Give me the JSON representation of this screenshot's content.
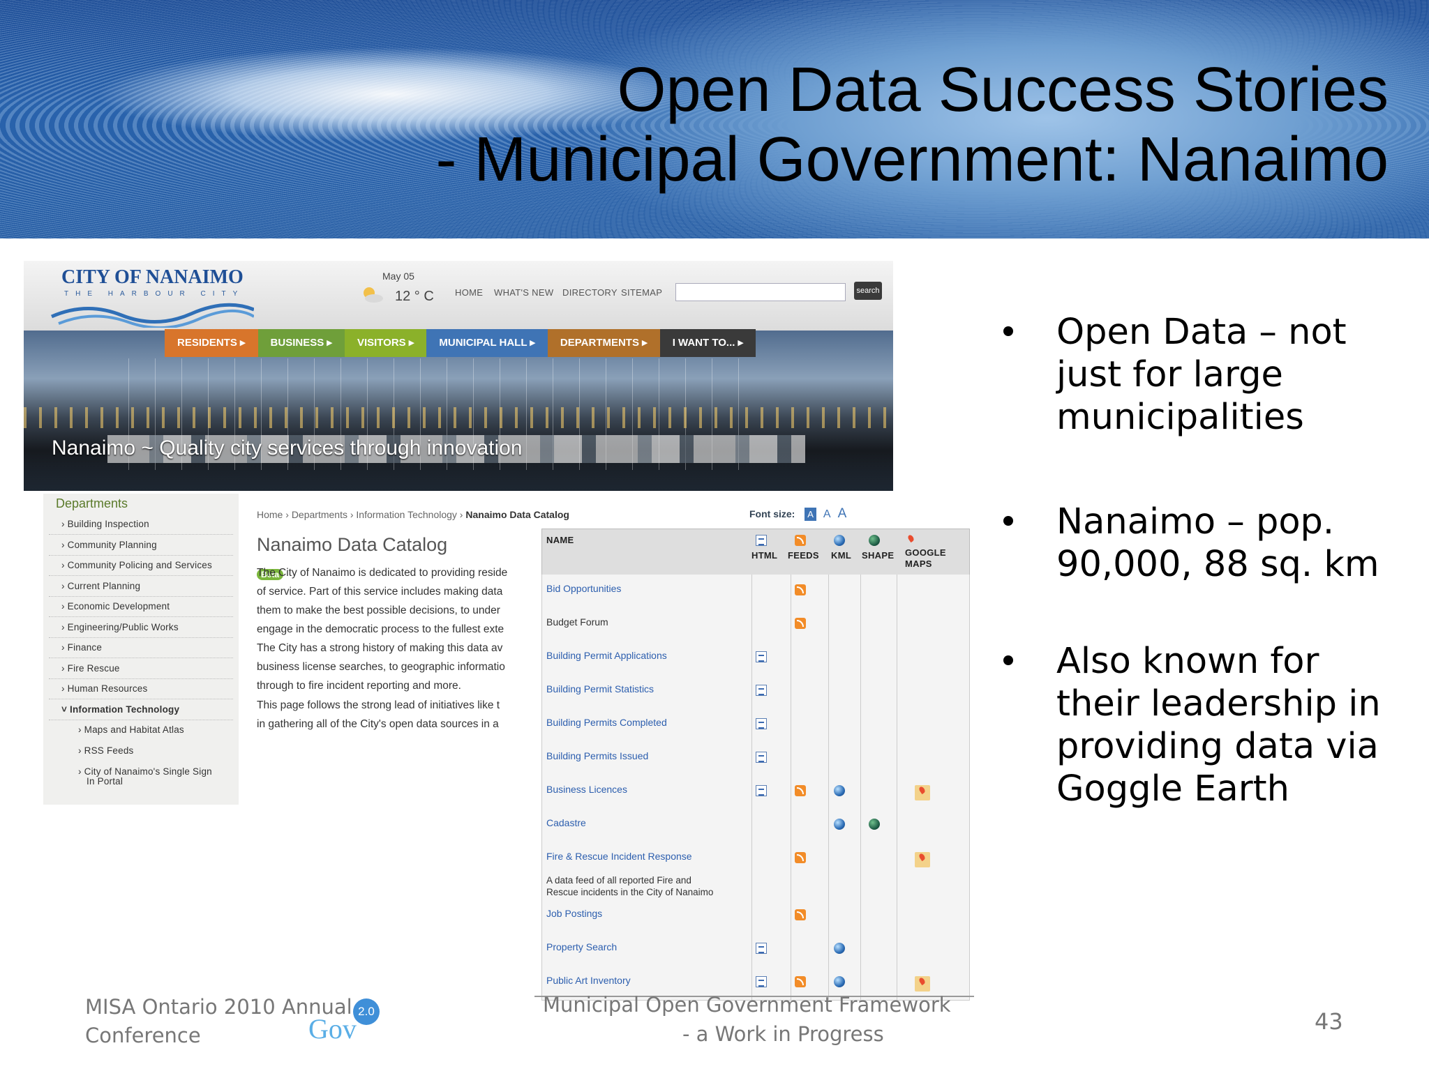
{
  "slide": {
    "title_line1": "Open Data Success Stories",
    "title_line2": "- Municipal Government:  Nanaimo",
    "bullets": [
      {
        "lines": [
          "Open Data – not",
          "just for large",
          "municipalities"
        ]
      },
      {
        "lines": [
          "Nanaimo – pop.",
          "90,000, 88 sq. km"
        ]
      },
      {
        "lines": [
          "Also known for",
          "their leadership in",
          "providing data via",
          "Goggle Earth"
        ]
      }
    ],
    "footer_left_line1": "MISA Ontario 2010 Annual",
    "footer_left_line2": "Conference",
    "footer_logo_version": "2.0",
    "footer_logo_word": "Gov",
    "footer_center_line1": "Municipal Open Government Framework",
    "footer_center_line2": "- a Work in Progress",
    "page_number": "43"
  },
  "site": {
    "logo_title": "CITY OF NANAIMO",
    "logo_sub": "THE HARBOUR CITY",
    "date": "May 05",
    "temperature": "12 ° C",
    "top_links": [
      "HOME",
      "WHAT'S NEW",
      "DIRECTORY",
      "SITEMAP"
    ],
    "search_button": "search",
    "main_nav": [
      {
        "label": "RESIDENTS",
        "color": "#d8752b"
      },
      {
        "label": "BUSINESS",
        "color": "#6f9f3a"
      },
      {
        "label": "VISITORS",
        "color": "#8bb12a"
      },
      {
        "label": "MUNICIPAL HALL",
        "color": "#3f74b5"
      },
      {
        "label": "DEPARTMENTS",
        "color": "#b0702a"
      },
      {
        "label": "I WANT TO...",
        "color": "#3a3a3a"
      }
    ],
    "tagline": "Nanaimo ~ Quality city services through innovation",
    "sidebar_heading": "Departments",
    "sidebar_items": [
      "Building Inspection",
      "Community Planning",
      "Community Policing and Services",
      "Current Planning",
      "Economic Development",
      "Engineering/Public Works",
      "Finance",
      "Fire Rescue",
      "Human Resources",
      "Information Technology"
    ],
    "sidebar_subitems": [
      "Maps and Habitat Atlas",
      "RSS Feeds",
      "City of Nanaimo's Single Sign",
      "In Portal"
    ],
    "breadcrumb": [
      "Home",
      "Departments",
      "Information Technology",
      "Nanaimo Data Catalog"
    ],
    "font_size_label": "Font size:",
    "font_size_options": [
      "A",
      "A",
      "A"
    ],
    "page_heading": "Nanaimo Data Catalog",
    "beta": "Beta",
    "para1": [
      "The City of Nanaimo is dedicated to providing reside",
      "of service.  Part of this service includes making data",
      "them to make the best possible decisions, to under",
      "engage in the democratic process to the fullest exte"
    ],
    "para2": [
      "The City has a strong history of making this data av",
      "business license searches, to geographic informatio",
      "through to fire incident reporting and more."
    ],
    "para3": [
      "This page follows the strong lead of initiatives like t",
      " in gathering all of the City's open data sources in a"
    ],
    "table": {
      "headers": {
        "name": "NAME",
        "html": "HTML",
        "feeds": "FEEDS",
        "kml": "KML",
        "shape": "SHAPE",
        "gmaps1": "GOOGLE",
        "gmaps2": "MAPS"
      },
      "rows": [
        {
          "name": "Bid Opportunities",
          "desc": [],
          "html": false,
          "feeds": true,
          "kml": false,
          "shape": false,
          "gmaps": false,
          "link": true
        },
        {
          "name": "Budget Forum",
          "desc": [],
          "html": false,
          "feeds": true,
          "kml": false,
          "shape": false,
          "gmaps": false,
          "link": false
        },
        {
          "name": "Building Permit Applications",
          "desc": [],
          "html": true,
          "feeds": false,
          "kml": false,
          "shape": false,
          "gmaps": false,
          "link": true
        },
        {
          "name": "Building Permit Statistics",
          "desc": [],
          "html": true,
          "feeds": false,
          "kml": false,
          "shape": false,
          "gmaps": false,
          "link": true
        },
        {
          "name": "Building Permits Completed",
          "desc": [],
          "html": true,
          "feeds": false,
          "kml": false,
          "shape": false,
          "gmaps": false,
          "link": true
        },
        {
          "name": "Building Permits Issued",
          "desc": [],
          "html": true,
          "feeds": false,
          "kml": false,
          "shape": false,
          "gmaps": false,
          "link": true
        },
        {
          "name": "Business Licences",
          "desc": [],
          "html": true,
          "feeds": true,
          "kml": true,
          "shape": false,
          "gmaps": true,
          "link": true
        },
        {
          "name": "Cadastre",
          "desc": [],
          "html": false,
          "feeds": false,
          "kml": true,
          "shape": true,
          "gmaps": false,
          "link": true
        },
        {
          "name": "Fire & Rescue Incident Response",
          "desc": [
            "A data feed of all reported Fire and",
            "Rescue incidents in the City of Nanaimo"
          ],
          "html": false,
          "feeds": true,
          "kml": false,
          "shape": false,
          "gmaps": true,
          "link": true
        },
        {
          "name": "Job Postings",
          "desc": [],
          "html": false,
          "feeds": true,
          "kml": false,
          "shape": false,
          "gmaps": false,
          "link": true
        },
        {
          "name": "Property Search",
          "desc": [],
          "html": true,
          "feeds": false,
          "kml": true,
          "shape": false,
          "gmaps": false,
          "link": true
        },
        {
          "name": "Public Art Inventory",
          "desc": [],
          "html": true,
          "feeds": true,
          "kml": true,
          "shape": false,
          "gmaps": true,
          "link": true
        }
      ]
    }
  }
}
